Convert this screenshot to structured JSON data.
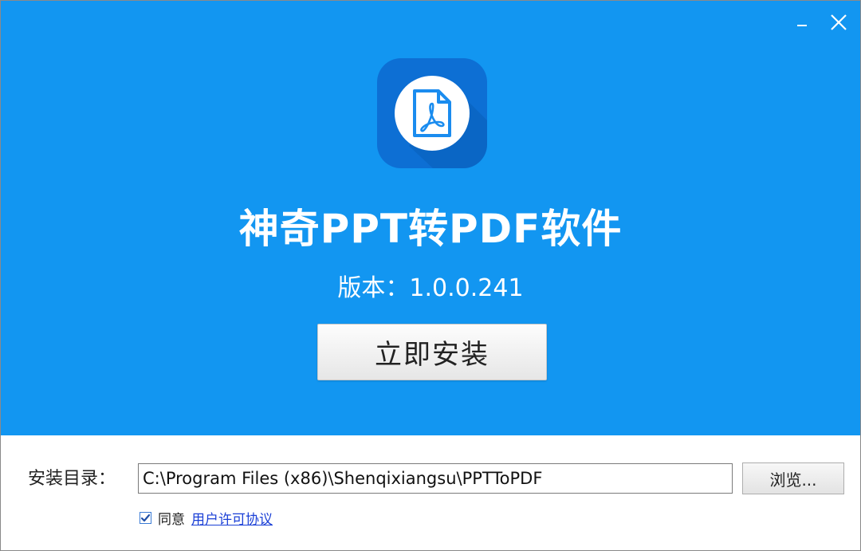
{
  "window": {
    "minimize_glyph": "—",
    "close_glyph": "✕"
  },
  "hero": {
    "app_title": "神奇PPT转PDF软件",
    "version_text": "版本：1.0.0.241",
    "install_button_label": "立即安装",
    "logo_icon": "pdf-file-icon"
  },
  "footer": {
    "dir_label": "安装目录：",
    "install_path": "C:\\Program Files (x86)\\Shenqixiangsu\\PPTToPDF",
    "browse_label": "浏览...",
    "agree_checked": true,
    "agree_label": "同意",
    "license_link": "用户许可协议"
  },
  "colors": {
    "hero_bg": "#1296f1",
    "logo_bg": "#0d6fd4",
    "link": "#1a3fd6"
  }
}
